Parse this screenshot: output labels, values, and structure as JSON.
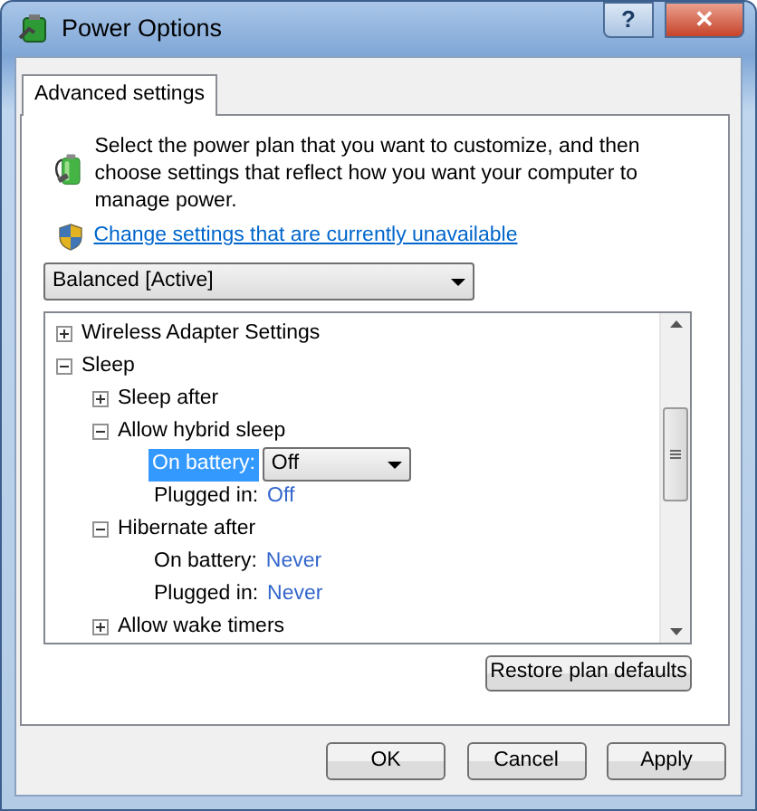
{
  "window": {
    "title": "Power Options",
    "help_button": "?",
    "close_button": "✕"
  },
  "tabs": [
    {
      "label": "Advanced settings",
      "selected": true
    }
  ],
  "description": "Select the power plan that you want to customize, and then choose settings that reflect how you want your computer to manage power.",
  "link": "Change settings that are currently unavailable",
  "plan_select": {
    "value": "Balanced [Active]"
  },
  "tree": [
    {
      "label": "Wireless Adapter Settings",
      "expanded": false
    },
    {
      "label": "Sleep",
      "expanded": true,
      "children": [
        {
          "label": "Sleep after",
          "expanded": false
        },
        {
          "label": "Allow hybrid sleep",
          "expanded": true,
          "children": [
            {
              "kind": "setting",
              "label": "On battery:",
              "value": "Off",
              "selected": true
            },
            {
              "kind": "setting",
              "label": "Plugged in:",
              "value": "Off",
              "selected": false
            }
          ]
        },
        {
          "label": "Hibernate after",
          "expanded": true,
          "children": [
            {
              "kind": "setting",
              "label": "On battery:",
              "value": "Never",
              "selected": false
            },
            {
              "kind": "setting",
              "label": "Plugged in:",
              "value": "Never",
              "selected": false
            }
          ]
        },
        {
          "label": "Allow wake timers",
          "expanded": false
        }
      ]
    }
  ],
  "restore_button": "Restore plan defaults",
  "buttons": [
    "OK",
    "Cancel",
    "Apply"
  ]
}
